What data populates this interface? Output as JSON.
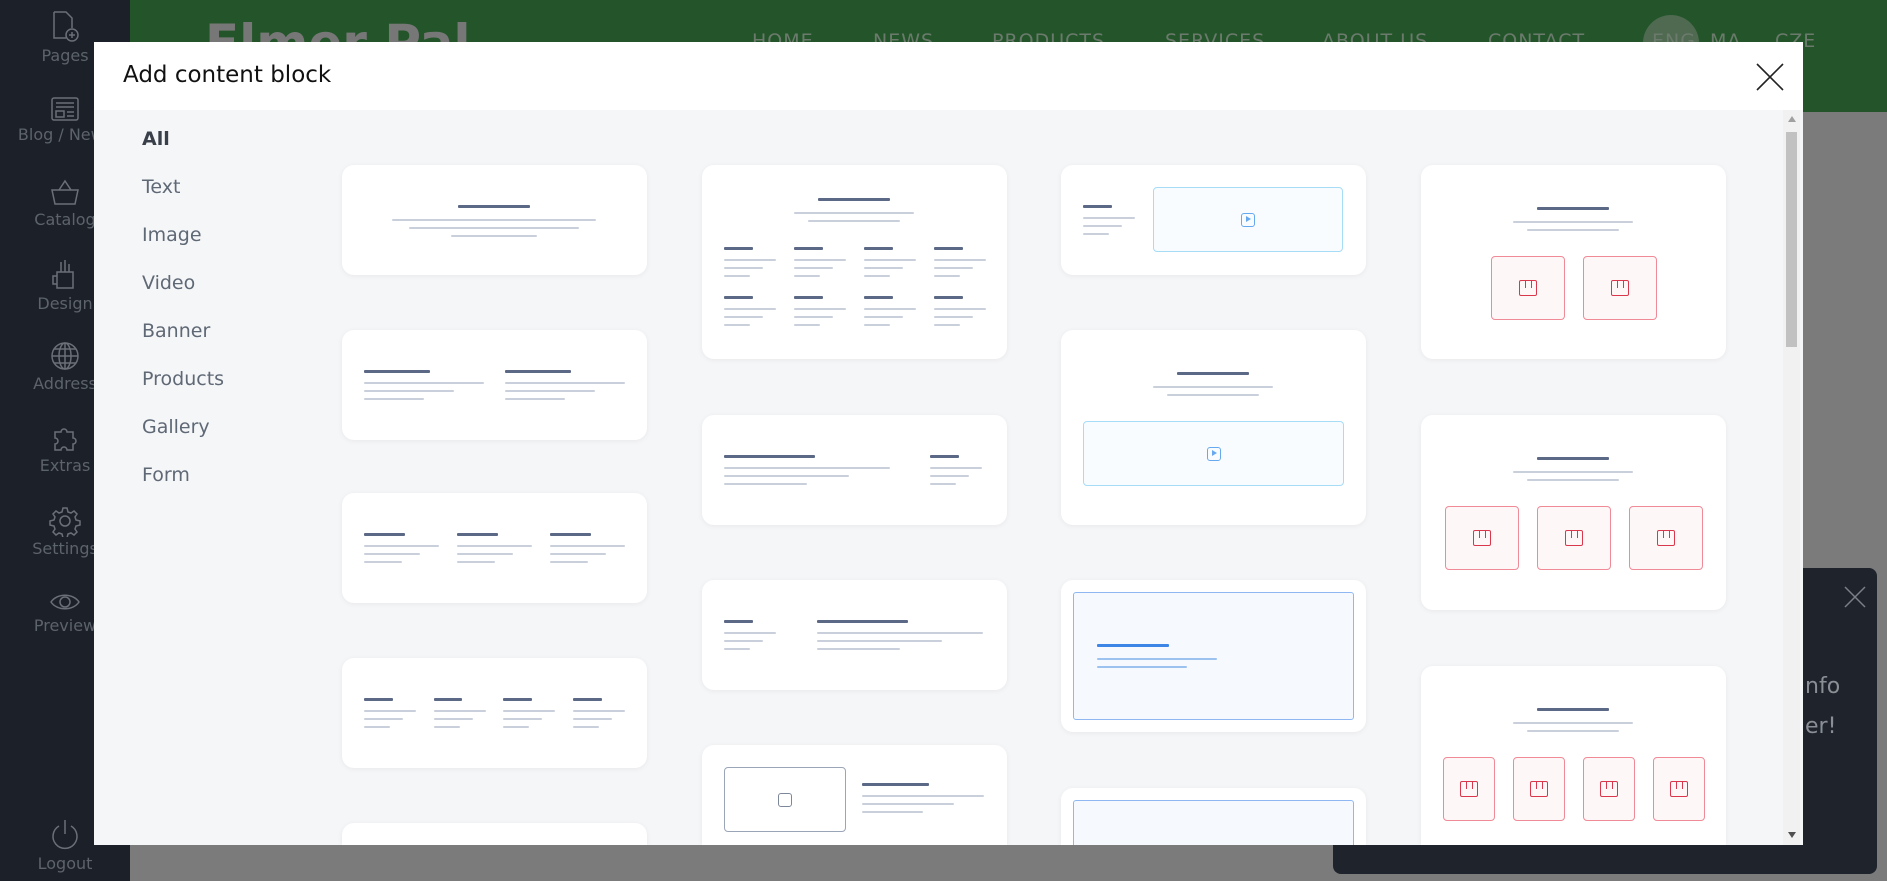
{
  "sidebar": {
    "items": [
      {
        "label": "Pages",
        "icon": "page-add-icon"
      },
      {
        "label": "Blog / News",
        "icon": "newspaper-icon"
      },
      {
        "label": "Catalog",
        "icon": "basket-icon"
      },
      {
        "label": "Design",
        "icon": "brush-cup-icon"
      },
      {
        "label": "Address",
        "icon": "globe-icon"
      },
      {
        "label": "Extras",
        "icon": "puzzle-icon"
      },
      {
        "label": "Settings",
        "icon": "gear-icon"
      },
      {
        "label": "Preview",
        "icon": "eye-icon"
      }
    ],
    "logout": {
      "label": "Logout",
      "icon": "power-icon"
    }
  },
  "site": {
    "name": "Elmer Pal",
    "nav": [
      "HOME",
      "NEWS",
      "PRODUCTS",
      "SERVICES",
      "ABOUT US",
      "CONTACT"
    ],
    "languages": [
      "ENG",
      "MA",
      "CZE"
    ],
    "header_color": "#24552a"
  },
  "notification": {
    "line1": "nfo",
    "line2": "er!"
  },
  "modal": {
    "title": "Add content block",
    "categories": [
      "All",
      "Text",
      "Image",
      "Video",
      "Banner",
      "Products",
      "Gallery",
      "Form"
    ],
    "active_category": "All"
  },
  "colors": {
    "accent_blue": "#3d86e6",
    "product_red": "#d9384c",
    "video_blue": "#a7dcf7"
  }
}
